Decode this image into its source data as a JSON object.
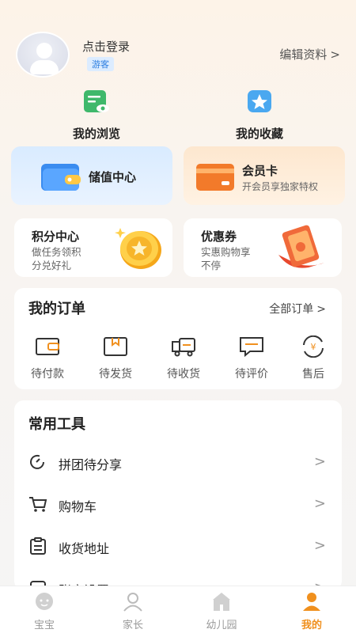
{
  "header": {
    "login_text": "点击登录",
    "guest_badge": "游客",
    "edit_profile": "编辑资料",
    "chevron": ">"
  },
  "quick": {
    "history_label": "我的浏览",
    "favorites_label": "我的收藏"
  },
  "cards": {
    "wallet_title": "储值中心",
    "vip_title": "会员卡",
    "vip_sub": "开会员享独家特权",
    "points_title": "积分中心",
    "points_sub1": "做任务领积",
    "points_sub2": "分兑好礼",
    "coupon_title": "优惠券",
    "coupon_sub1": "实惠购物享",
    "coupon_sub2": "不停"
  },
  "orders": {
    "title": "我的订单",
    "all_label": "全部订单",
    "items": [
      {
        "label": "待付款"
      },
      {
        "label": "待发货"
      },
      {
        "label": "待收货"
      },
      {
        "label": "待评价"
      },
      {
        "label": "售后"
      }
    ]
  },
  "tools": {
    "title": "常用工具",
    "items": [
      {
        "label": "拼团待分享"
      },
      {
        "label": "购物车"
      },
      {
        "label": "收货地址"
      },
      {
        "label": "账户设置"
      }
    ]
  },
  "tabbar": {
    "items": [
      {
        "label": "宝宝"
      },
      {
        "label": "家长"
      },
      {
        "label": "幼儿园"
      },
      {
        "label": "我的"
      }
    ],
    "active_color": "#f0901e"
  },
  "colors": {
    "accent": "#f0901e",
    "badge_blue": "#2a7de0"
  }
}
